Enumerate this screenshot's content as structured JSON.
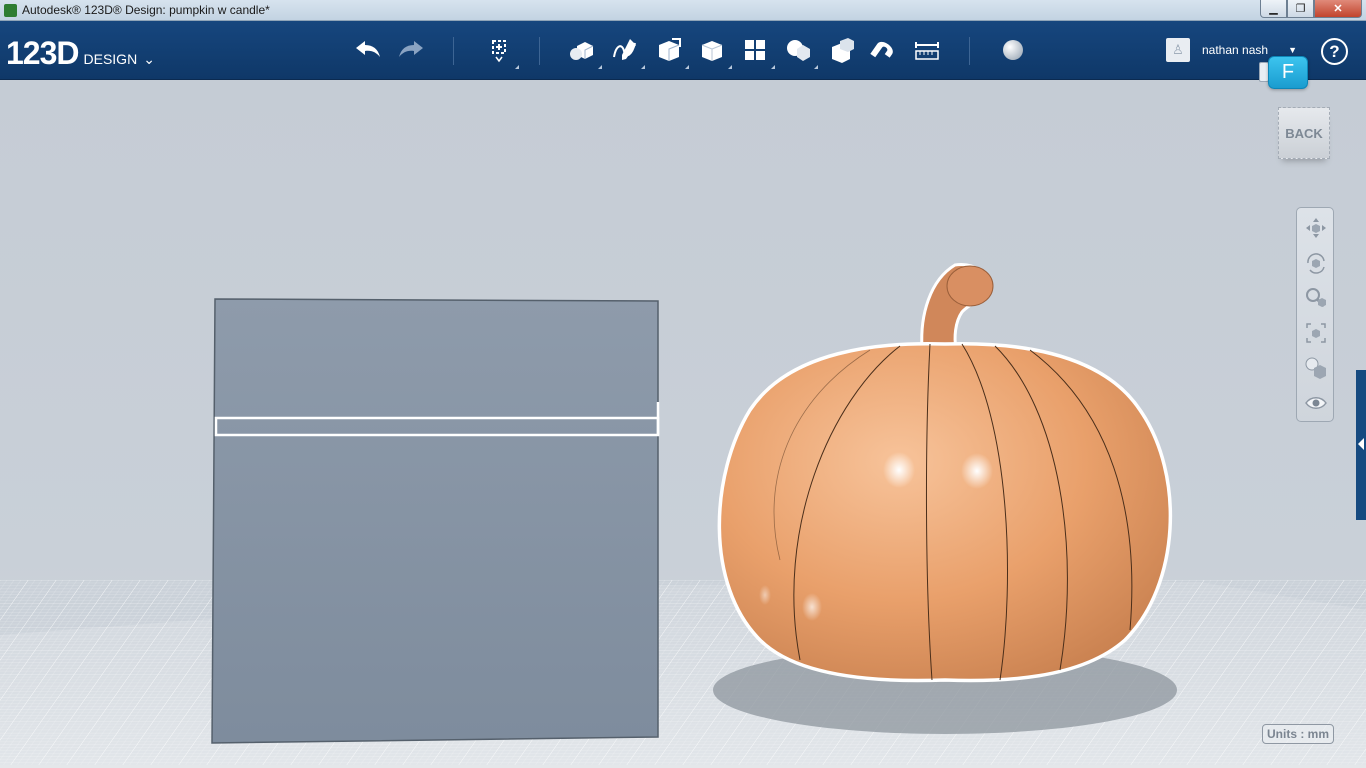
{
  "window": {
    "title": "Autodesk® 123D® Design: pumpkin w candle*",
    "min_symbol": "▁",
    "max_symbol": "❐",
    "close_symbol": "✕"
  },
  "toolbar": {
    "logo_main": "123D",
    "logo_sub": "DESIGN",
    "logo_caret": "⌄",
    "tools": [
      {
        "name": "undo-icon"
      },
      {
        "name": "redo-icon"
      },
      {
        "name": "transform-icon"
      },
      {
        "name": "primitives-icon"
      },
      {
        "name": "sketch-icon"
      },
      {
        "name": "construct-icon"
      },
      {
        "name": "modify-icon"
      },
      {
        "name": "pattern-icon"
      },
      {
        "name": "grouping-icon"
      },
      {
        "name": "combine-icon"
      },
      {
        "name": "snap-icon"
      },
      {
        "name": "measure-icon"
      },
      {
        "name": "material-icon"
      }
    ],
    "user_name": "nathan nash",
    "user_caret": "▼",
    "help_symbol": "?",
    "badge_letter": "F"
  },
  "viewport": {
    "viewcube_label": "BACK",
    "units_label": "Units : mm",
    "colors": {
      "box": "#8a98a8",
      "pumpkin": "#e8a16a",
      "stem": "#c98a5a",
      "grid": "#ffffff"
    }
  },
  "navbar": {
    "buttons": [
      {
        "name": "pan-icon"
      },
      {
        "name": "orbit-icon"
      },
      {
        "name": "zoom-icon"
      },
      {
        "name": "fit-icon"
      },
      {
        "name": "view-style-icon"
      },
      {
        "name": "visibility-icon"
      }
    ]
  }
}
